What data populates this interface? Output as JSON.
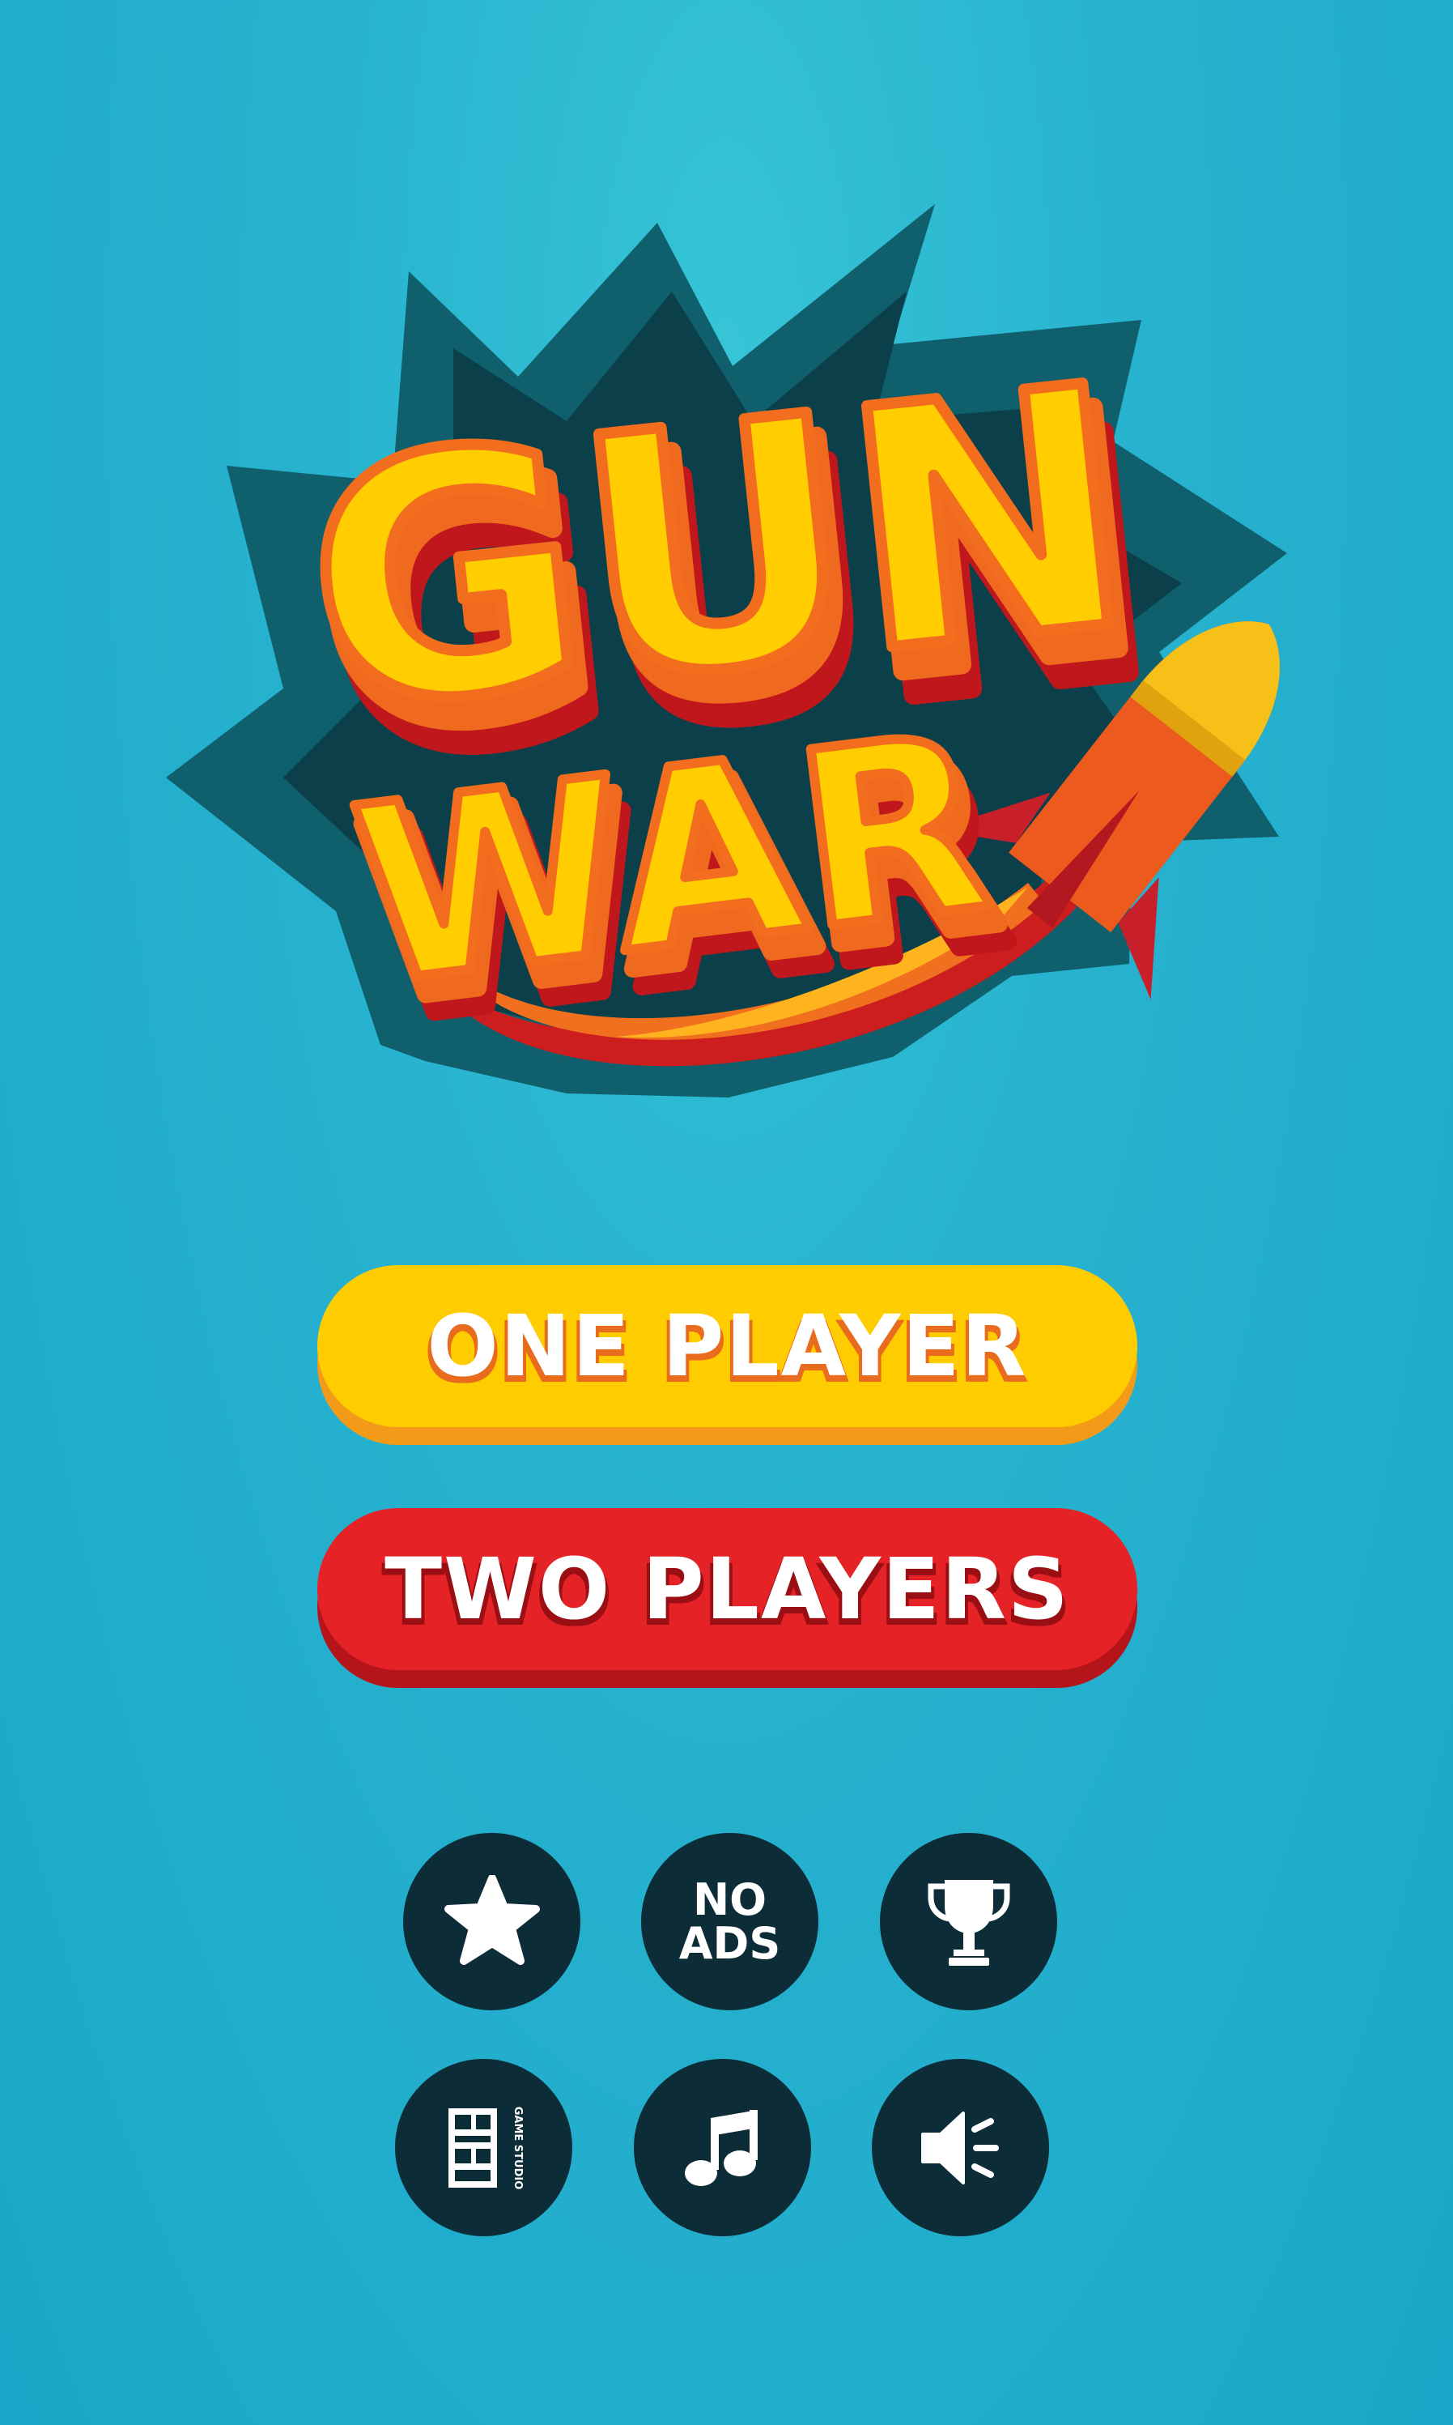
{
  "logo": {
    "line1": "GUN",
    "line2": "WAR"
  },
  "menu": {
    "one_player_label": "ONE PLAYER",
    "two_players_label": "TWO PLAYERS"
  },
  "icons": {
    "no_ads_line1": "NO",
    "no_ads_line2": "ADS",
    "studio_logo_text": "GAME STUDIO"
  },
  "colors": {
    "background": "#1aa6c8",
    "one_player_button": "#ffcc00",
    "two_players_button": "#e52226",
    "icon_button": "#0c2d38"
  },
  "icon_names": [
    "star-icon",
    "no-ads-icon",
    "trophy-icon",
    "studio-logo-icon",
    "music-icon",
    "sound-icon"
  ]
}
